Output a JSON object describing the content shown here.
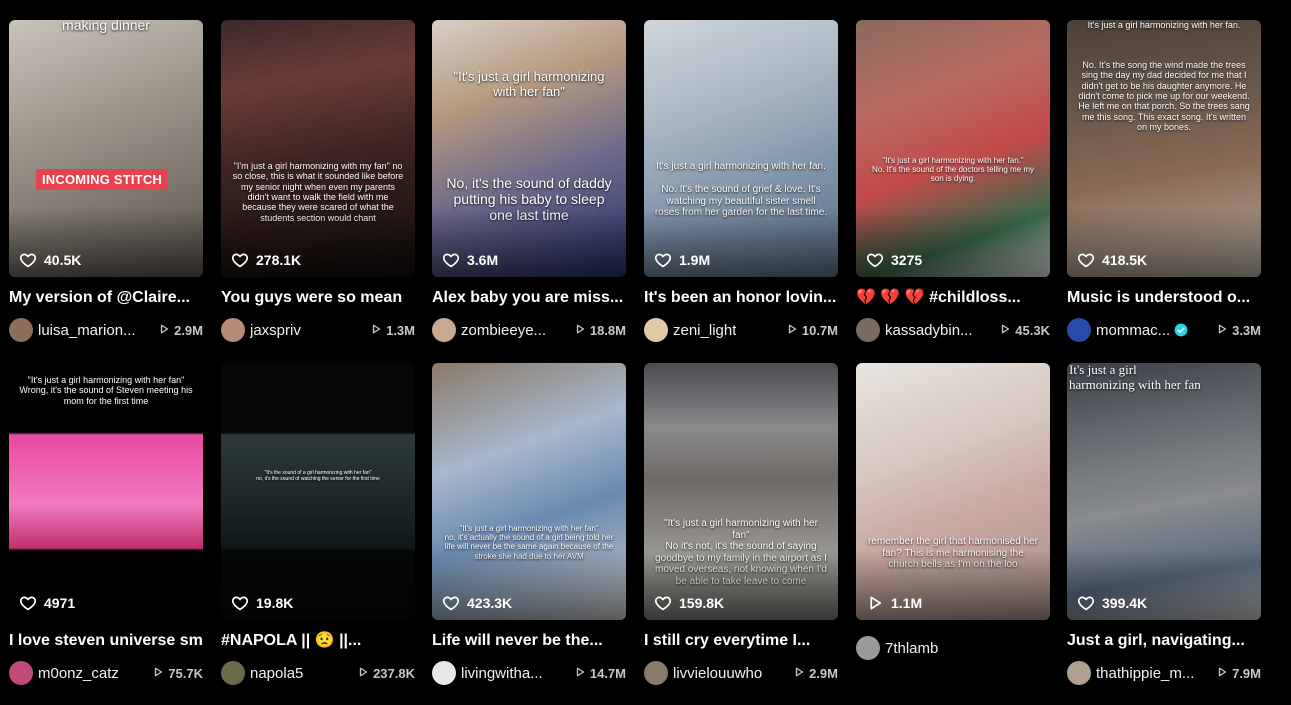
{
  "row1": [
    {
      "overlay_top": "making dinner",
      "overlay": "",
      "tag": "INCOMING STITCH",
      "count": "40.5K",
      "count_icon": "heart-icon",
      "caption": "My version of @Claire...",
      "author": "luisa_marion...",
      "plays": "2.9M",
      "bg": "linear-gradient(160deg,#c9c3bb 0%,#a29a8f 35%,#7b746b 70%,#5a544d 100%)",
      "avatar": "#8c6e5a",
      "verified": false
    },
    {
      "overlay_top": "",
      "overlay": "\"I'm just a girl harmonizing with my fan\" no so close, this is what it sounded like before my senior night when even my parents didn't want to walk the field with me because they were scared of what the students section would chant",
      "tag": "",
      "count": "278.1K",
      "count_icon": "heart-icon",
      "caption": "You guys were so mean",
      "author": "jaxspriv",
      "plays": "1.3M",
      "bg": "linear-gradient(170deg,#3a2a2a 0%,#6b3b36 25%,#3a2320 55%,#120d0c 100%)",
      "avatar": "#b88a78",
      "verified": false
    },
    {
      "overlay_top": "\"It's just a girl harmonizing with her fan\"",
      "overlay": "No, it's the sound of daddy putting his baby to sleep one last time",
      "tag": "",
      "count": "3.6M",
      "count_icon": "heart-icon",
      "caption": "Alex baby you are miss...",
      "author": "zombieeye...",
      "plays": "18.8M",
      "bg": "linear-gradient(160deg,#d8cfc6 0%,#b59a80 30%,#6e6a8a 60%,#27306a 100%)",
      "avatar": "#c9a890",
      "verified": false
    },
    {
      "overlay_top": "",
      "overlay": "It's just a girl harmonizing with her fan.\n\nNo. It's the sound of grief & love. It's watching my beautiful sister smell roses from her garden for the last time.",
      "tag": "",
      "count": "1.9M",
      "count_icon": "heart-icon",
      "caption": "It's been an honor lovin...",
      "author": "zeni_light",
      "plays": "10.7M",
      "bg": "linear-gradient(160deg,#cfd6dc 0%,#a9b6c2 35%,#7e93a8 65%,#5b6f86 100%)",
      "avatar": "#e0c9a5",
      "verified": false
    },
    {
      "overlay_top": "",
      "overlay": "\"It's just a girl harmonizing with her fan.\"\nNo. It's the sound of the doctors telling me my son is dying.",
      "tag": "",
      "count": "3275",
      "count_icon": "heart-icon",
      "caption": "💔 💔 💔 #childloss...",
      "author": "kassadybin...",
      "plays": "45.3K",
      "bg": "linear-gradient(160deg,#8a6a5c 0%,#b86a62 30%,#c24a4a 55%,#3a6a4a 80%,#e6e6e6 100%)",
      "avatar": "#7a6a60",
      "verified": false
    },
    {
      "overlay_top": "It's just a girl harmonizing with her fan.",
      "overlay": "No. It's the song the wind made the trees sing the day my dad decided for me that I didn't get to be his daughter anymore. He didn't come to pick me up for our weekend. He left me on that porch. So the trees sang me this song. This exact song. It's written on my bones.",
      "tag": "",
      "count": "418.5K",
      "count_icon": "heart-icon",
      "caption": "Music is understood o...",
      "author": "mommac...",
      "plays": "3.3M",
      "bg": "linear-gradient(170deg,#4a4038 0%,#6b5a4c 35%,#8a6a54 60%,#b8b0a4 100%)",
      "avatar": "#2a4aa8",
      "verified": true
    }
  ],
  "row2": [
    {
      "overlay_top": "\"It's just a girl harmonizing with her fan\" Wrong, it's the sound of Steven meeting his mom for the first time",
      "overlay": "",
      "tag": "",
      "count": "4971",
      "count_icon": "heart-icon",
      "caption": "I love steven universe sm",
      "author": "m0onz_catz",
      "plays": "75.7K",
      "bg": "linear-gradient(180deg,#000 0%,#000 27%,#e84aa0 28%,#f07ac0 55%,#c0306a 72%,#000 73%,#000 100%)",
      "avatar": "#c04a7a",
      "verified": false
    },
    {
      "overlay_top": "",
      "overlay": "\"It's the sound of a girl harmonizing with her fan\"\nno, it's the sound of watching the senior for the first time",
      "tag": "",
      "count": "19.8K",
      "count_icon": "heart-icon",
      "caption": "#NAPOLA || 😟 ||...",
      "author": "napola5",
      "plays": "237.8K",
      "bg": "linear-gradient(180deg,#050606 0%,#050606 27%,#2c3a3c 28%,#1c2628 55%,#101617 72%,#050606 73%,#050606 100%)",
      "avatar": "#6a6a4a",
      "verified": false
    },
    {
      "overlay_top": "",
      "overlay": "\"It's just a girl harmonizing with her fan\"\nno, it's actually the sound of a girl being told her life will never be the same again because of the stroke she had due to her AVM",
      "tag": "",
      "count": "423.3K",
      "count_icon": "heart-icon",
      "caption": "Life will never be the...",
      "author": "livingwitha...",
      "plays": "14.7M",
      "bg": "linear-gradient(160deg,#8a7a6a 0%,#a8b8cc 35%,#6a8ab0 60%,#c8c8c8 100%)",
      "avatar": "#e8e8e8",
      "verified": false
    },
    {
      "overlay_top": "",
      "overlay": "\"It's just a girl harmonizing with her fan\"\nNo it's not, it's the sound of saying goodbye to my family in the airport as I moved overseas, not knowing when I'd be able to take leave to come",
      "tag": "",
      "count": "159.8K",
      "count_icon": "heart-icon",
      "caption": "I still cry everytime I...",
      "author": "livvielouuwho",
      "plays": "2.9M",
      "bg": "linear-gradient(180deg,#4a4a50 0%,#8a8a8c 25%,#6e6a66 45%,#9a9894 75%,#7a7874 100%)",
      "avatar": "#8a7a6a",
      "verified": false
    },
    {
      "overlay_top": "",
      "overlay": "remember the girl that harmonised her fan? This is me harmonising the church bells as I'm on the loo",
      "tag": "",
      "count": "1.1M",
      "count_icon": "play-icon",
      "caption": "",
      "author": "7thlamb",
      "plays": "",
      "bg": "linear-gradient(160deg,#e8e4e0 0%,#d6c8c0 35%,#c8a8a0 60%,#a89088 100%)",
      "avatar": "#9a9a9a",
      "verified": false
    },
    {
      "overlay_top": "It's just a girl harmonizing with her fan",
      "overlay": "",
      "tag": "",
      "count": "399.4K",
      "count_icon": "heart-icon",
      "caption": "Just a girl, navigating...",
      "author": "thathippie_m...",
      "plays": "7.9M",
      "bg": "linear-gradient(170deg,#3a4048 0%,#6a6e74 30%,#8a8c8e 55%,#5a6a80 80%,#c8c8c8 100%)",
      "avatar": "#b0a090",
      "verified": false
    }
  ]
}
